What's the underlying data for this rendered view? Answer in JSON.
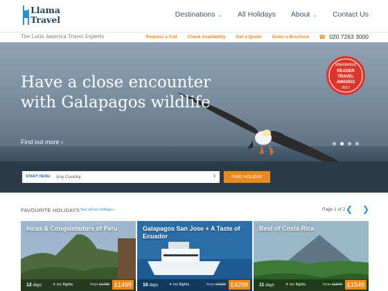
{
  "header": {
    "logo_line1": "Llama",
    "logo_line2": "Travel",
    "nav": [
      {
        "label": "Destinations",
        "has_dropdown": true
      },
      {
        "label": "All Holidays",
        "has_dropdown": false
      },
      {
        "label": "About",
        "has_dropdown": true
      },
      {
        "label": "Contact Us",
        "has_dropdown": false
      }
    ]
  },
  "subbar": {
    "tagline": "The Latin America Travel Experts",
    "links": [
      "Request a Call",
      "Check Availability",
      "Get a Quote",
      "Order a Brochure"
    ],
    "phone": "020 7263 3000"
  },
  "hero": {
    "title": "Have a close encounter with Galapagos wildlife",
    "cta": "Find out more",
    "award_lines": [
      "Wanderlust",
      "READER",
      "TRAVEL",
      "AWARDS",
      "2017"
    ],
    "slides": 4,
    "active_slide": 2
  },
  "search": {
    "start_label": "START HERE:",
    "country_value": "Any Country",
    "button_label": "FIND HOLIDAY"
  },
  "favourites": {
    "heading": "FAVOURITE HOLIDAYS",
    "see_all": "See all our holidays",
    "page_info": "Page 1 of 2",
    "cards": [
      {
        "title": "Incas & Conquistadors of Peru",
        "days": "12",
        "days_label": "days",
        "flights": "inc flights",
        "from_label": "from",
        "old_price": "£1795",
        "price": "£1499"
      },
      {
        "title": "Galapagos San Jose + A Taste of Ecuador",
        "days": "16",
        "days_label": "days",
        "flights": "inc flights",
        "from_label": "from",
        "old_price": "£4599",
        "price": "£4299"
      },
      {
        "title": "Best of Costa Rica",
        "days": "11",
        "days_label": "days",
        "flights": "inc flights",
        "from_label": "from",
        "old_price": "£1849",
        "price": "£1549"
      }
    ]
  },
  "colors": {
    "accent": "#e8891b",
    "link": "#2a8fc8",
    "search_band": "#2b3a47"
  }
}
